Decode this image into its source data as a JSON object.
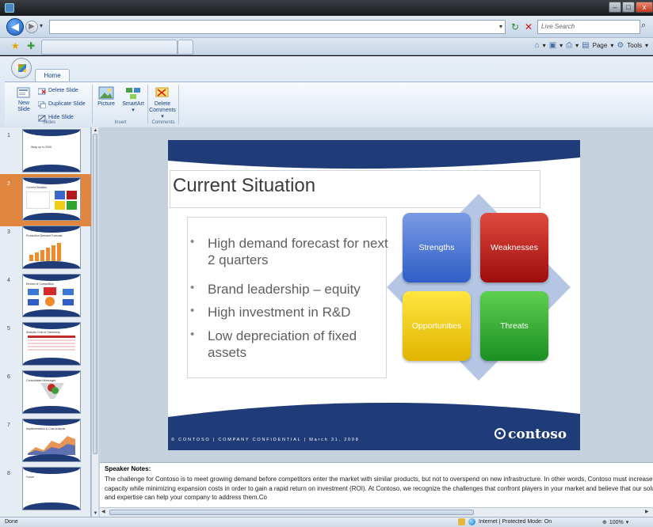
{
  "browser": {
    "search_placeholder": "Live Search",
    "cmd": {
      "page_label": "Page",
      "tools_label": "Tools"
    },
    "status": {
      "done": "Done",
      "zone": "Internet | Protected Mode: On",
      "zoom": "100%"
    }
  },
  "ribbon": {
    "tab_home": "Home",
    "buttons": {
      "new_slide": "New Slide",
      "delete_slide": "Delete Slide",
      "duplicate_slide": "Duplicate Slide",
      "hide_slide": "Hide Slide",
      "picture": "Picture",
      "smartart": "SmartArt",
      "delete_comments": "Delete Comments"
    },
    "groups": {
      "slides": "Slides",
      "insert": "Insert",
      "comments": "Comments"
    }
  },
  "thumbnails": [
    {
      "num": "1",
      "title": "Wrap up to 2009"
    },
    {
      "num": "2",
      "title": "Current Situation"
    },
    {
      "num": "3",
      "title": "Production Demand Forecast"
    },
    {
      "num": "4",
      "title": "Review of Competition"
    },
    {
      "num": "5",
      "title": "Analysis Cost of Ownership"
    },
    {
      "num": "6",
      "title": "Consolidated Messages"
    },
    {
      "num": "7",
      "title": "Implementation & Cost Analysis"
    },
    {
      "num": "8",
      "title": "Future"
    }
  ],
  "slide": {
    "title": "Current Situation",
    "bullets": [
      "High demand forecast for next 2 quarters",
      "Brand leadership – equity",
      "High investment in R&D",
      "Low depreciation of fixed assets"
    ],
    "swot": {
      "strengths": "Strengths",
      "weaknesses": "Weaknesses",
      "opportunities": "Opportunities",
      "threats": "Threats"
    },
    "footer": "© CONTOSO  |  COMPANY CONFIDENTIAL  |  March 31, 2008",
    "logo": "contoso"
  },
  "notes": {
    "title": "Speaker Notes:",
    "body": "The challenge for Contoso is to meet growing demand before competitors enter the market with similar products, but not to overspend on new infrastructure. In other words, Contoso must increase capacity while minimizing expansion costs in order to gain a rapid return on investment (ROI). At Contoso, we recognize the challenges that confront players in your market and believe that our solutions and expertise can help your company to address them.Co"
  },
  "colors": {
    "slide_navy": "#1f3b78",
    "selection": "#e0863f"
  }
}
